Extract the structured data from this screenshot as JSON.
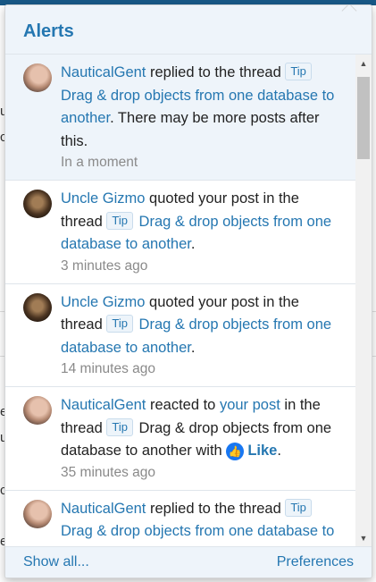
{
  "popup": {
    "title": "Alerts",
    "footer": {
      "show_all": "Show all...",
      "preferences": "Preferences"
    }
  },
  "alerts": [
    {
      "user": "NauticalGent",
      "action": " replied to the thread ",
      "tag": "Tip",
      "thread": "Drag & drop objects from one database to another",
      "suffix": ". There may be more posts after this.",
      "time": "In a moment"
    },
    {
      "user": "Uncle Gizmo",
      "action": " quoted your post in the thread ",
      "tag": "Tip",
      "thread": "Drag & drop objects from one database to another",
      "suffix": ".",
      "time": "3 minutes ago"
    },
    {
      "user": "Uncle Gizmo",
      "action": " quoted your post in the thread ",
      "tag": "Tip",
      "thread": "Drag & drop objects from one database to another",
      "suffix": ".",
      "time": "14 minutes ago"
    },
    {
      "user": "NauticalGent",
      "action": " reacted to ",
      "target": "your post",
      "action2": " in the thread ",
      "tag": "Tip",
      "thread": "Drag & drop objects from one database to another",
      "with_text": " with ",
      "reaction": "Like",
      "suffix": ".",
      "time": "35 minutes ago"
    },
    {
      "user": "NauticalGent",
      "action": " replied to the thread ",
      "tag": "Tip",
      "thread": "Drag & drop objects from one database to another"
    }
  ],
  "background_glyphs": [
    "u",
    "c",
    "e",
    "u",
    "c",
    "e"
  ],
  "colors": {
    "accent": "#2577b1",
    "header_bg": "#eef4fa",
    "like_blue": "#1877f2"
  }
}
